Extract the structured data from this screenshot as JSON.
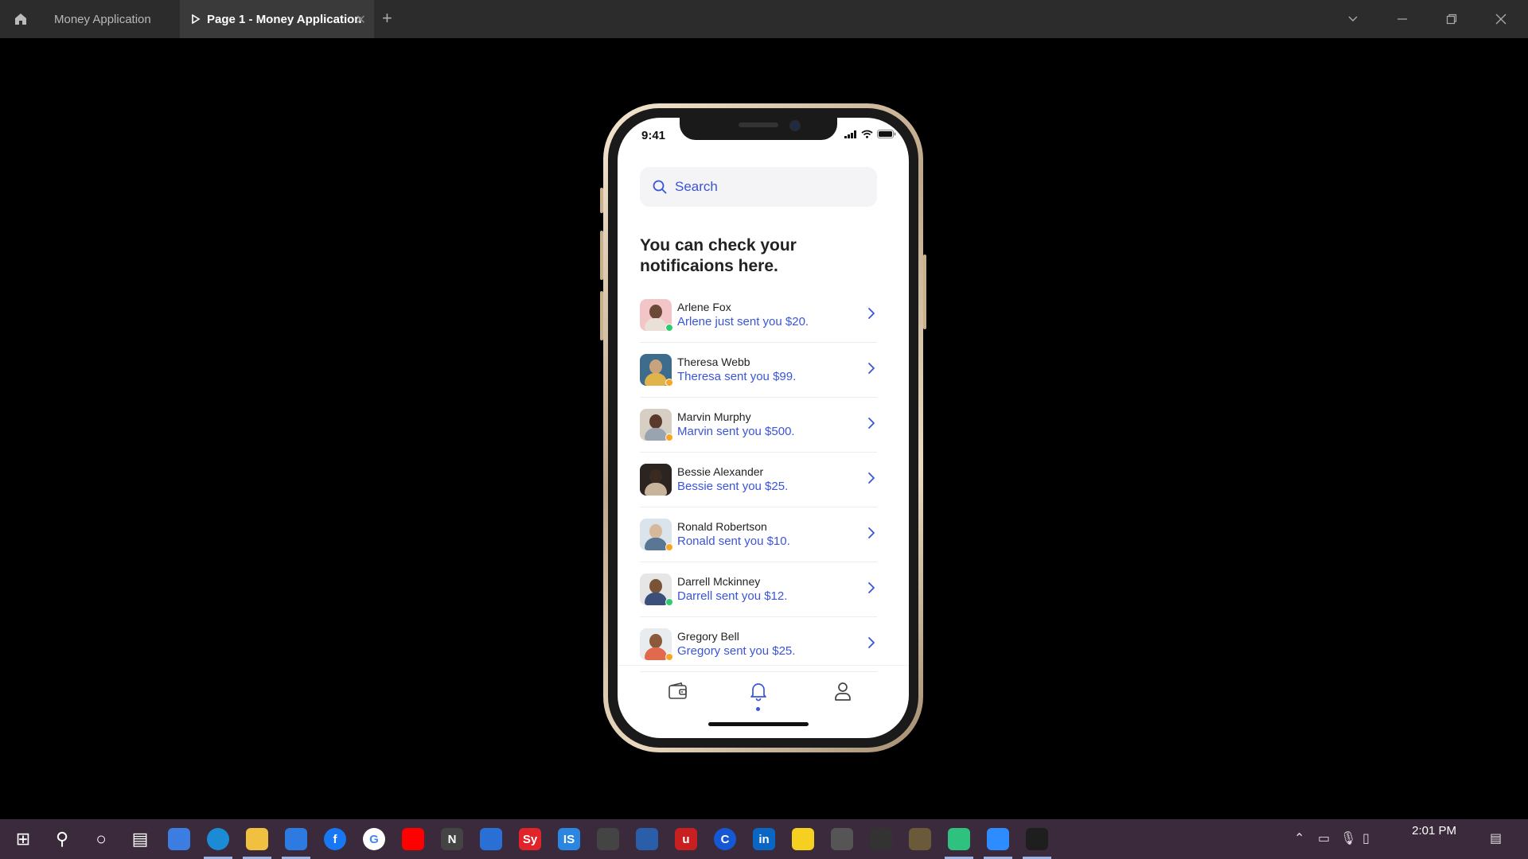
{
  "window": {
    "tabs": [
      {
        "label": "Money Application",
        "active": false
      },
      {
        "label": "Page 1 - Money Application",
        "active": true
      }
    ]
  },
  "status_bar": {
    "time": "9:41"
  },
  "search": {
    "placeholder": "Search"
  },
  "heading": "You can check your notificaions here.",
  "notifications": [
    {
      "name": "Arlene Fox",
      "message": "Arlene just sent you $20.",
      "status": "online",
      "avatar_bg": "#f2c6c6"
    },
    {
      "name": "Theresa Webb",
      "message": "Theresa sent you $99.",
      "status": "away",
      "avatar_bg": "#3d6c8c"
    },
    {
      "name": "Marvin Murphy",
      "message": "Marvin sent you $500.",
      "status": "away",
      "avatar_bg": "#d8cfc4"
    },
    {
      "name": "Bessie Alexander",
      "message": "Bessie sent you $25.",
      "status": "none",
      "avatar_bg": "#2c2420"
    },
    {
      "name": "Ronald Robertson",
      "message": "Ronald sent you $10.",
      "status": "away",
      "avatar_bg": "#dbe4ea"
    },
    {
      "name": "Darrell Mckinney",
      "message": "Darrell sent you $12.",
      "status": "online",
      "avatar_bg": "#e6e6e6"
    },
    {
      "name": "Gregory Bell",
      "message": "Gregory sent you $25.",
      "status": "away",
      "avatar_bg": "#e9ecef"
    }
  ],
  "tabbar": [
    {
      "icon": "wallet-icon",
      "active": false
    },
    {
      "icon": "bell-icon",
      "active": true
    },
    {
      "icon": "profile-icon",
      "active": false
    }
  ],
  "colors": {
    "accent": "#3a55d8",
    "online": "#2ecc71",
    "away": "#f5a623",
    "titlebar": "#2c2c2c",
    "taskbar": "#3b2a3b"
  },
  "taskbar": {
    "clock": "2:01 PM",
    "apps": [
      "windows-start-icon",
      "search-icon",
      "cortana-icon",
      "task-view-icon",
      "vscode-icon",
      "edge-icon",
      "file-explorer-icon",
      "mail-icon",
      "facebook-icon",
      "google-icon",
      "youtube-icon",
      "notion-icon",
      "zoho-icon",
      "sy-icon",
      "is-icon",
      "cisco-icon",
      "app-arrows-icon",
      "u-app-icon",
      "c-app-icon",
      "linkedin-icon",
      "sticky-notes-icon",
      "app-dark-icon",
      "github-icon",
      "image-app-icon",
      "app-green-icon",
      "zoom-icon",
      "figma-icon"
    ],
    "app_letters": {
      "notion-icon": "N",
      "sy-icon": "Sy",
      "is-icon": "IS",
      "linkedin-icon": "in",
      "c-app-icon": "C",
      "u-app-icon": "u",
      "google-icon": "G",
      "facebook-icon": "f"
    }
  }
}
